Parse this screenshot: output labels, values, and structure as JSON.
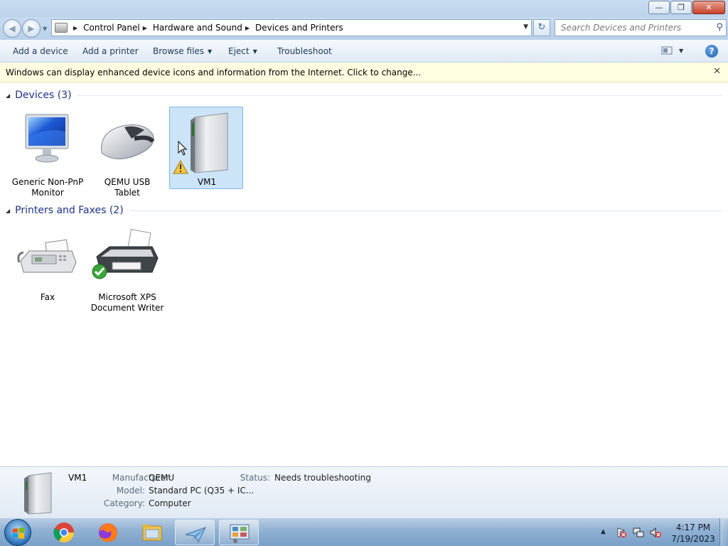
{
  "window": {
    "minimize_glyph": "—",
    "maximize_glyph": "❐",
    "close_glyph": "✕"
  },
  "nav": {
    "back_glyph": "◀",
    "forward_glyph": "▶",
    "breadcrumbs": [
      "Control Panel",
      "Hardware and Sound",
      "Devices and Printers"
    ],
    "refresh_glyph": "↻"
  },
  "search": {
    "placeholder": "Search Devices and Printers",
    "value": ""
  },
  "commands": {
    "add_device": "Add a device",
    "add_printer": "Add a printer",
    "browse_files": "Browse files",
    "eject": "Eject",
    "troubleshoot": "Troubleshoot",
    "help": "?"
  },
  "infobar": {
    "message": "Windows can display enhanced device icons and information from the Internet. Click to change...",
    "close_glyph": "✕"
  },
  "groups": {
    "devices": {
      "title": "Devices (3)",
      "items": [
        {
          "label": "Generic Non-PnP Monitor",
          "icon": "monitor-icon"
        },
        {
          "label": "QEMU USB Tablet",
          "icon": "mouse-icon"
        },
        {
          "label": "VM1",
          "icon": "computer-tower-icon",
          "selected": true,
          "warning": true
        }
      ]
    },
    "printers": {
      "title": "Printers and Faxes (2)",
      "items": [
        {
          "label": "Fax",
          "icon": "fax-icon"
        },
        {
          "label": "Microsoft XPS Document Writer",
          "icon": "printer-icon",
          "default": true
        }
      ]
    }
  },
  "details": {
    "name": "VM1",
    "manufacturer_label": "Manufacturer:",
    "manufacturer": "QEMU",
    "model_label": "Model:",
    "model": "Standard PC (Q35 + IC...",
    "category_label": "Category:",
    "category": "Computer",
    "status_label": "Status:",
    "status": "Needs troubleshooting"
  },
  "taskbar": {
    "apps": [
      "chrome-icon",
      "firefox-icon",
      "file-explorer-icon",
      "paper-plane-icon",
      "control-panel-icon"
    ],
    "clock_time": "4:17 PM",
    "clock_date": "7/19/2023"
  },
  "colors": {
    "accent": "#1e3287",
    "selection": "#cce4f7",
    "infobar_bg": "#ffffe1"
  }
}
